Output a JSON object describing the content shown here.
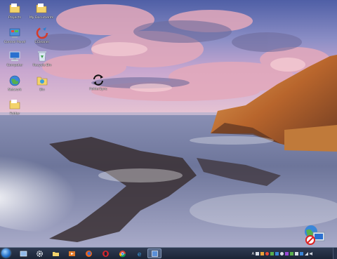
{
  "desktop": {
    "icons": [
      {
        "label": "Projects",
        "icon": "folder-icon"
      },
      {
        "label": "My Documents",
        "icon": "folder-icon"
      },
      {
        "label": "Control Panel",
        "icon": "control-panel-icon"
      },
      {
        "label": "CCleaner",
        "icon": "ccleaner-icon"
      },
      {
        "label": "Computer",
        "icon": "computer-icon"
      },
      {
        "label": "Recycle Bin",
        "icon": "recycle-bin-icon"
      },
      {
        "label": "Network",
        "icon": "network-icon"
      },
      {
        "label": "Bin",
        "icon": "folder-icon"
      },
      {
        "label": "FolderSync",
        "icon": "sync-icon"
      },
      {
        "label": "Folder",
        "icon": "folder-icon"
      }
    ]
  },
  "taskbar": {
    "items": [
      {
        "name": "start-button",
        "icon": "windows-orb-icon"
      },
      {
        "name": "taskbar-window",
        "icon": "window-icon"
      },
      {
        "name": "taskbar-settings",
        "icon": "gear-icon"
      },
      {
        "name": "taskbar-explorer",
        "icon": "folder-icon"
      },
      {
        "name": "taskbar-media",
        "icon": "media-player-icon"
      },
      {
        "name": "taskbar-firefox",
        "icon": "firefox-icon"
      },
      {
        "name": "taskbar-opera",
        "icon": "opera-icon"
      },
      {
        "name": "taskbar-chrome",
        "icon": "chrome-icon"
      },
      {
        "name": "taskbar-ie",
        "icon": "internet-explorer-icon"
      },
      {
        "name": "taskbar-app-active",
        "icon": "app-icon"
      }
    ],
    "tray": {
      "ime": "A"
    }
  },
  "colors": {
    "taskbar_top": "#2f3b52",
    "taskbar_bottom": "#1b2436",
    "sky": "#8a93c4",
    "cloud": "#d9a0b8",
    "rock": "#c26a2e",
    "sea": "#7c86a8"
  }
}
